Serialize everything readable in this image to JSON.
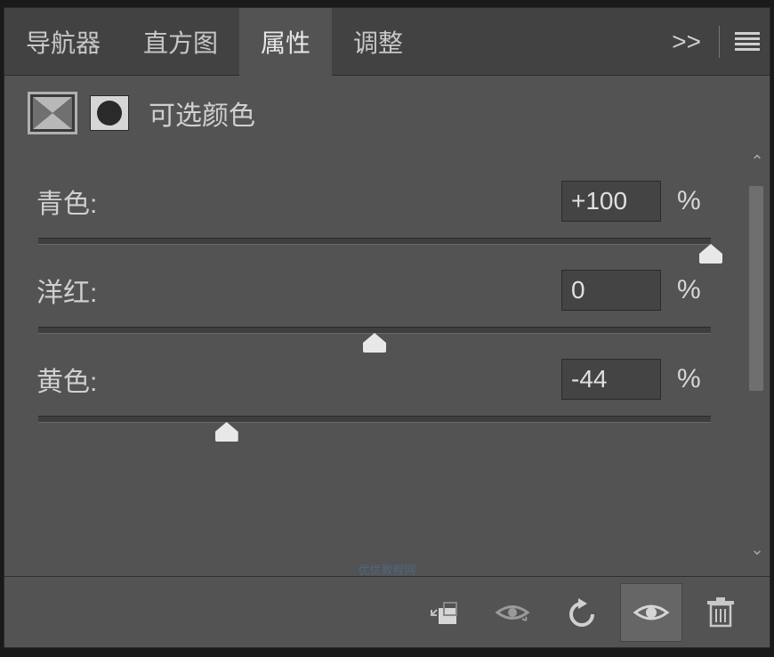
{
  "tabs": {
    "navigator": "导航器",
    "histogram": "直方图",
    "properties": "属性",
    "adjustments": "调整"
  },
  "collapse_label": ">>",
  "header": {
    "title": "可选颜色"
  },
  "sliders": [
    {
      "label": "青色:",
      "value": "+100",
      "unit": "%",
      "pos": 100
    },
    {
      "label": "洋红:",
      "value": "0",
      "unit": "%",
      "pos": 50
    },
    {
      "label": "黄色:",
      "value": "-44",
      "unit": "%",
      "pos": 28
    }
  ],
  "watermark": "优优教程网"
}
